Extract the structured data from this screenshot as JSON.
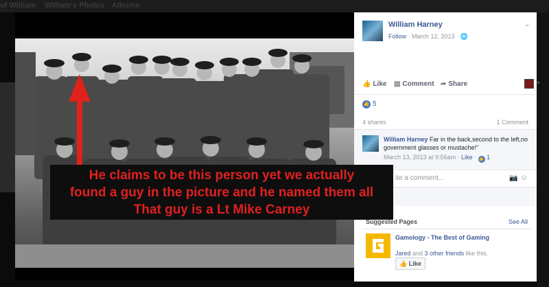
{
  "top_nav": {
    "left_fragment": "of William",
    "photos_tab": "William's Photos",
    "albums_tab": "Albums"
  },
  "caption": {
    "line1": "He claims to be this person yet we actually",
    "line2": "found a guy in the picture and he named them all",
    "line3": "That guy is a Lt Mike Carney",
    "color": "#e02020"
  },
  "post": {
    "author": "William Harney",
    "follow": "Follow",
    "date": " · March 12, 2013 · ",
    "privacy_icon": "globe-icon",
    "menu_icon": "chevron-down-icon"
  },
  "actions": {
    "like": "Like",
    "comment": "Comment",
    "share": "Share"
  },
  "reactions": {
    "count": "5"
  },
  "stats": {
    "shares": "4 shares",
    "comments": "1 Comment"
  },
  "comment": {
    "author": "William Harney",
    "text": "Far in the back,second to the left,no government glasses or mustache!\"",
    "date": "March 13, 2013 at 9:56am · ",
    "like": "Like",
    "sep": " · ",
    "likes": "1"
  },
  "write_comment": {
    "placeholder": "ite a comment..."
  },
  "suggested": {
    "header": "Suggested Pages",
    "see_all": "See All",
    "page_name": "Gamology - The Best of Gaming",
    "friends_prefix": "Jared",
    "friends_mid": " and ",
    "friends_link": "3 other friends",
    "friends_suffix": " like this.",
    "like_button": "Like"
  },
  "colors": {
    "link_blue": "#3b5998",
    "brand_yellow": "#f5b800"
  }
}
